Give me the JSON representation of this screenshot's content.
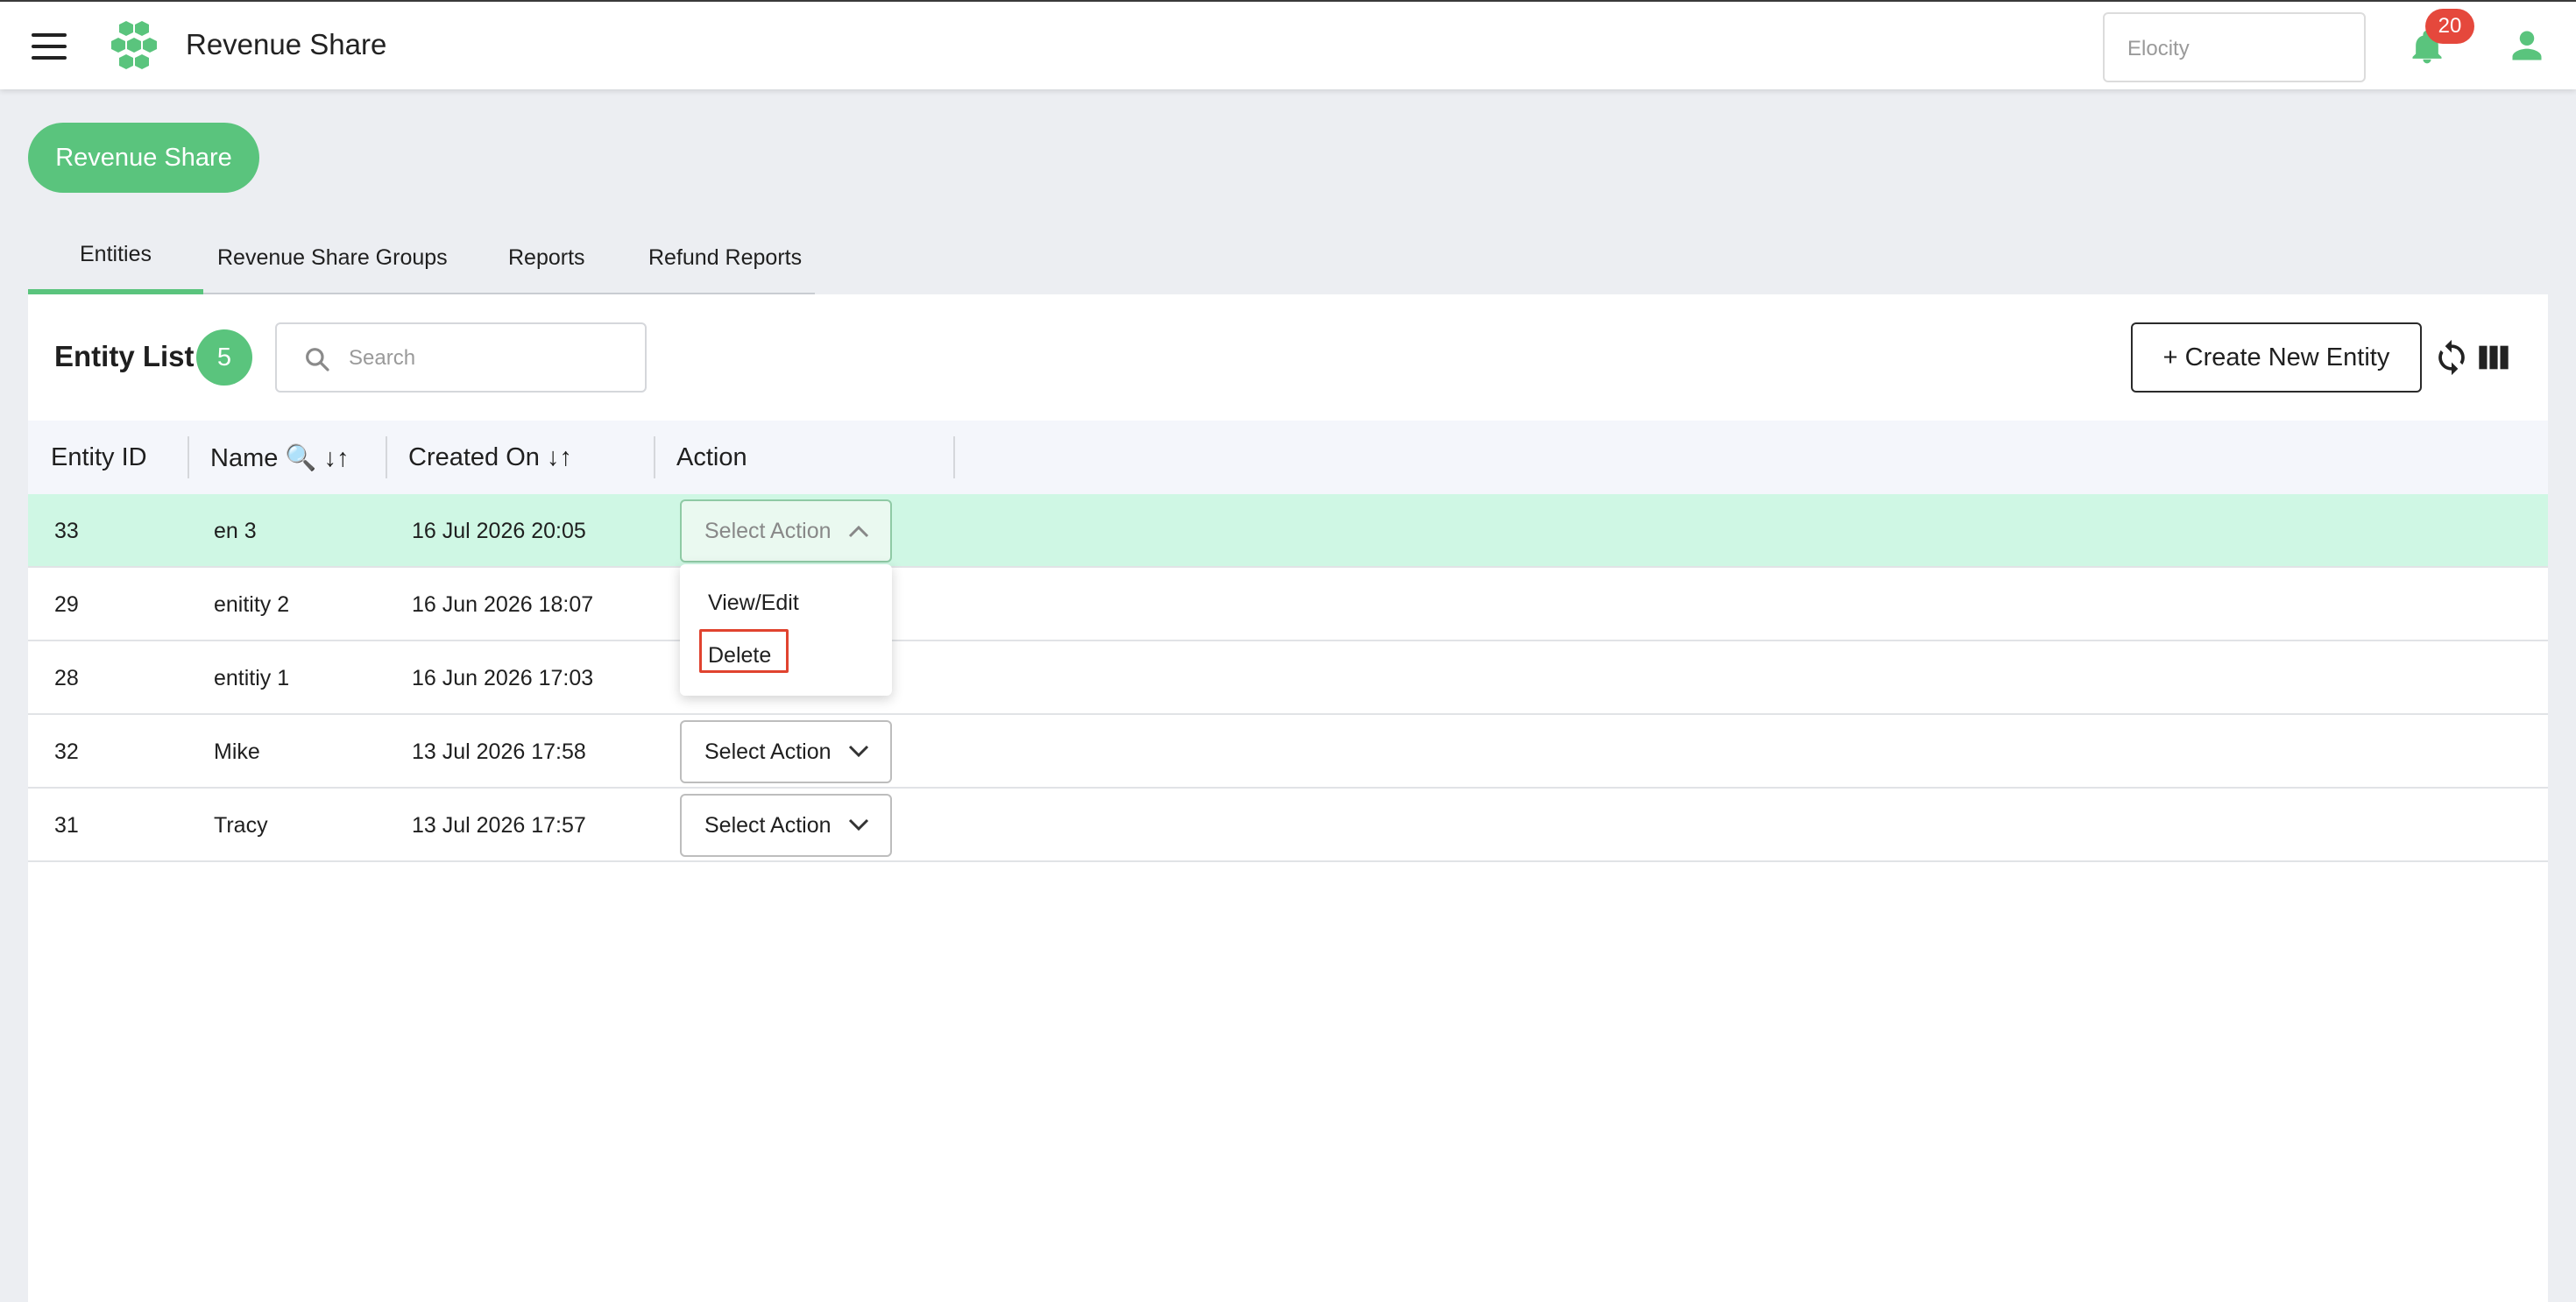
{
  "app": {
    "title": "Revenue Share"
  },
  "header": {
    "org_value": "Elocity",
    "notifications_count": "20"
  },
  "page_button_label": "Revenue Share",
  "tabs": [
    {
      "label": "Entities"
    },
    {
      "label": "Revenue Share Groups"
    },
    {
      "label": "Reports"
    },
    {
      "label": "Refund Reports"
    }
  ],
  "entity_list": {
    "title": "Entity List",
    "count": "5",
    "search_placeholder": "Search",
    "create_label": "+ Create New Entity"
  },
  "table": {
    "columns": [
      "Entity ID",
      "Name 🔍 ↓↑",
      "Created On ↓↑",
      "Action"
    ],
    "rows": [
      {
        "id": "33",
        "name": "en 3",
        "created": "16 Jul 2026 20:05",
        "action": "Select Action"
      },
      {
        "id": "29",
        "name": "enitity 2",
        "created": "16 Jun 2026 18:07",
        "action": "Select Action"
      },
      {
        "id": "28",
        "name": "entitiy 1",
        "created": "16 Jun 2026 17:03",
        "action": "Select Action"
      },
      {
        "id": "32",
        "name": "Mike",
        "created": "13 Jul 2026 17:58",
        "action": "Select Action"
      },
      {
        "id": "31",
        "name": "Tracy",
        "created": "13 Jul 2026 17:57",
        "action": "Select Action"
      }
    ]
  },
  "action_menu": {
    "items": [
      "View/Edit",
      "Delete"
    ]
  },
  "colors": {
    "accent": "#5ac47d",
    "highlight_row": "#cff7e4",
    "badge": "#e5483c",
    "annotation": "#e0432f"
  }
}
